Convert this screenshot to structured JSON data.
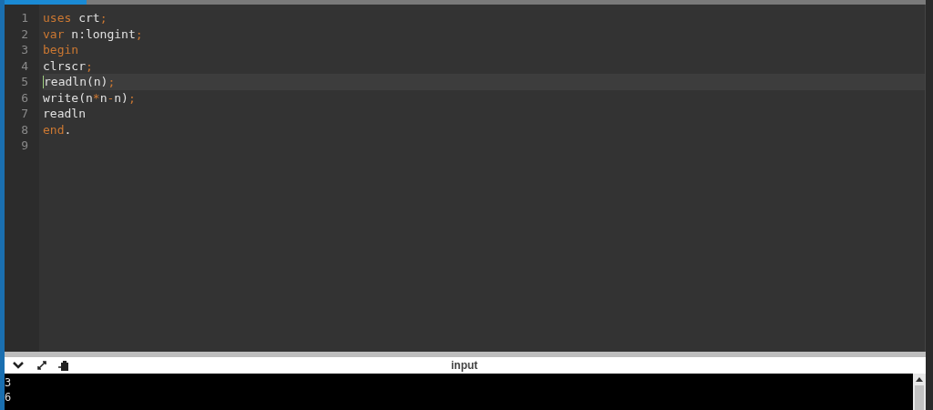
{
  "editor": {
    "lines": [
      {
        "number": "1",
        "active": false,
        "tokens": [
          {
            "text": "uses",
            "kind": "keyword"
          },
          {
            "text": " crt",
            "kind": "plain"
          },
          {
            "text": ";",
            "kind": "operator"
          }
        ]
      },
      {
        "number": "2",
        "active": false,
        "tokens": [
          {
            "text": "var",
            "kind": "keyword"
          },
          {
            "text": " n:longint",
            "kind": "plain"
          },
          {
            "text": ";",
            "kind": "operator"
          }
        ]
      },
      {
        "number": "3",
        "active": false,
        "tokens": [
          {
            "text": "begin",
            "kind": "keyword"
          }
        ]
      },
      {
        "number": "4",
        "active": false,
        "tokens": [
          {
            "text": "clrscr",
            "kind": "plain"
          },
          {
            "text": ";",
            "kind": "operator"
          }
        ]
      },
      {
        "number": "5",
        "active": true,
        "tokens": [
          {
            "text": "readln(n)",
            "kind": "plain"
          },
          {
            "text": ";",
            "kind": "operator"
          }
        ]
      },
      {
        "number": "6",
        "active": false,
        "tokens": [
          {
            "text": "write(n",
            "kind": "plain"
          },
          {
            "text": "*",
            "kind": "operator"
          },
          {
            "text": "n",
            "kind": "plain"
          },
          {
            "text": "-",
            "kind": "operator"
          },
          {
            "text": "n)",
            "kind": "plain"
          },
          {
            "text": ";",
            "kind": "operator"
          }
        ]
      },
      {
        "number": "7",
        "active": false,
        "tokens": [
          {
            "text": "readln",
            "kind": "plain"
          }
        ]
      },
      {
        "number": "8",
        "active": false,
        "tokens": [
          {
            "text": "end",
            "kind": "keyword"
          },
          {
            "text": ".",
            "kind": "plain"
          }
        ]
      },
      {
        "number": "9",
        "active": false
      }
    ]
  },
  "console": {
    "title": "input",
    "output": [
      "3",
      "6"
    ]
  }
}
